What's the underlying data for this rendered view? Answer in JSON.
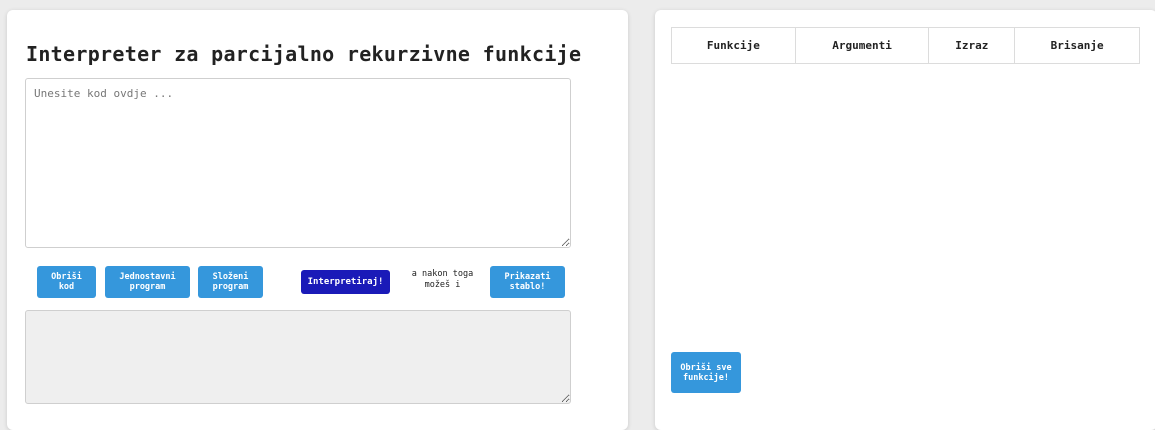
{
  "left": {
    "title": "Interpreter za parcijalno rekurzivne funkcije",
    "code_placeholder": "Unesite kod ovdje ...",
    "code_value": "",
    "buttons": {
      "obrisi_kod": "Obriši kod",
      "jednostavni": "Jednostavni program",
      "slozeni": "Složeni program",
      "interpretiraj": "Interpretiraj!",
      "prikazati": "Prikazati stablo!"
    },
    "hint": "a nakon toga možeš i",
    "output_value": ""
  },
  "right": {
    "table_headers": [
      "Funkcije",
      "Argumenti",
      "Izraz",
      "Brisanje"
    ],
    "rows": [],
    "obrisi_sve": "Obriši sve funkcije!"
  },
  "colors": {
    "button_primary": "#3597dc",
    "button_interpret": "#1a1ab8",
    "output_background": "#efefef"
  }
}
